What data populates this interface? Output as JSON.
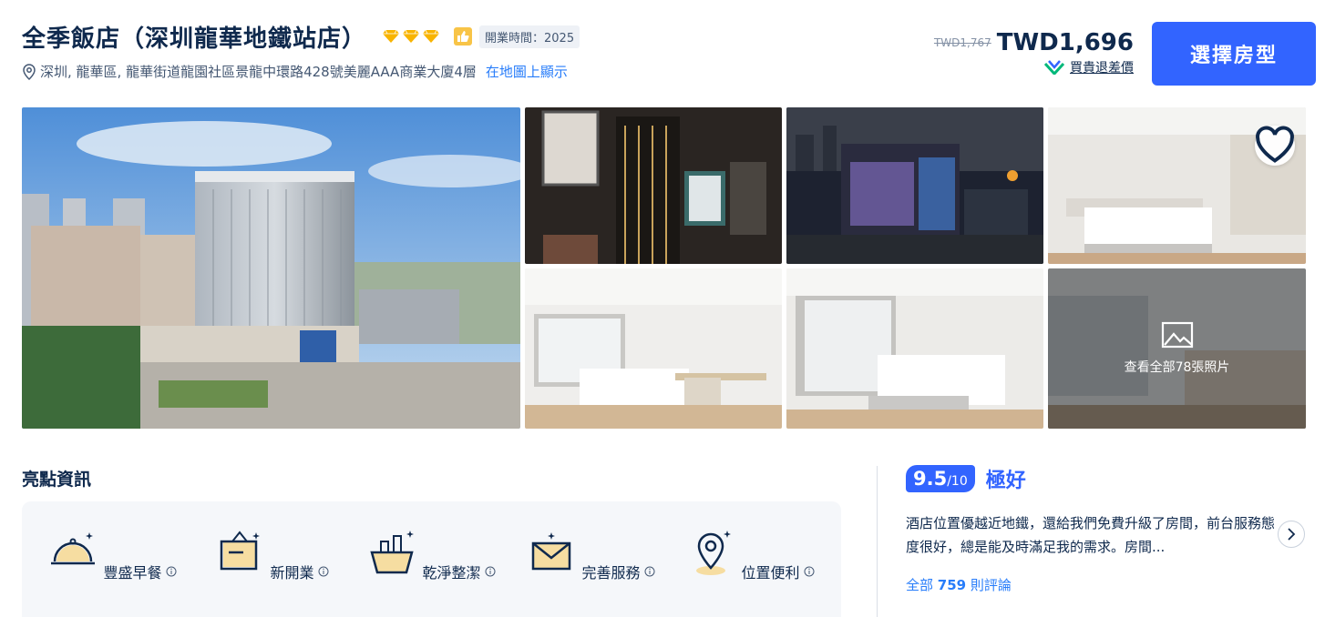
{
  "hotel": {
    "name": "全季飯店（深圳龍華地鐵站店）",
    "open_time": "開業時間：2025",
    "address": "深圳, 龍華區, 龍華街道龍園社區景龍中環路428號美麗AAA商業大廈4層",
    "map_link": "在地圖上顯示",
    "star_icon": "diamond-icon",
    "accent_color": "#3264ff"
  },
  "price": {
    "original": "TWD1,767",
    "current": "TWD1,696",
    "guarantee": "買貴退差價",
    "book_button": "選擇房型"
  },
  "gallery": {
    "view_all": "查看全部78張照片"
  },
  "highlights": {
    "title": "亮點資訊",
    "items": [
      {
        "label": "豐盛早餐",
        "icon": "breakfast-cloche-icon"
      },
      {
        "label": "新開業",
        "icon": "new-opening-sign-icon"
      },
      {
        "label": "乾淨整潔",
        "icon": "cleaning-basket-icon"
      },
      {
        "label": "完善服務",
        "icon": "service-envelope-icon"
      },
      {
        "label": "位置便利",
        "icon": "location-pin-icon"
      }
    ]
  },
  "review": {
    "score": "9.5",
    "out_of": "/10",
    "rating_word": "極好",
    "snippet": "酒店位置優越近地鐵，還給我們免費升級了房間，前台服務態度很好，總是能及時滿足我的需求。房間...",
    "all_prefix": "全部",
    "count": "759",
    "all_suffix": "則評論"
  }
}
